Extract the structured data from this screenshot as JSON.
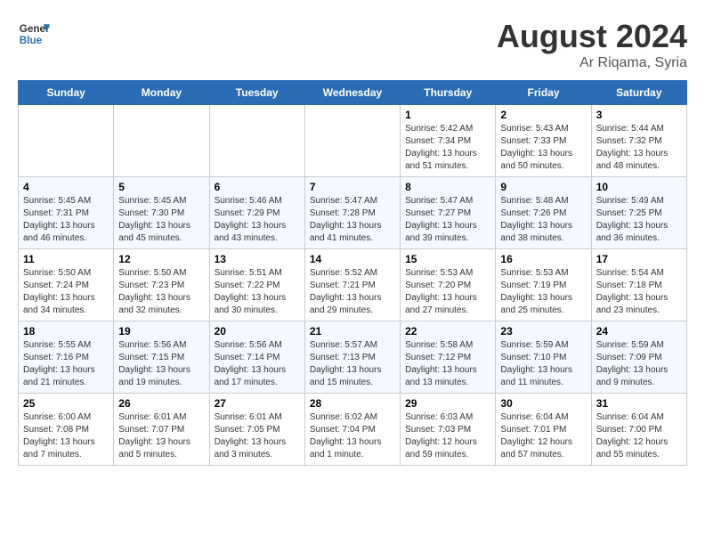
{
  "header": {
    "logo_general": "General",
    "logo_blue": "Blue",
    "month_year": "August 2024",
    "location": "Ar Riqama, Syria"
  },
  "weekdays": [
    "Sunday",
    "Monday",
    "Tuesday",
    "Wednesday",
    "Thursday",
    "Friday",
    "Saturday"
  ],
  "weeks": [
    [
      {
        "day": "",
        "info": ""
      },
      {
        "day": "",
        "info": ""
      },
      {
        "day": "",
        "info": ""
      },
      {
        "day": "",
        "info": ""
      },
      {
        "day": "1",
        "info": "Sunrise: 5:42 AM\nSunset: 7:34 PM\nDaylight: 13 hours and 51 minutes."
      },
      {
        "day": "2",
        "info": "Sunrise: 5:43 AM\nSunset: 7:33 PM\nDaylight: 13 hours and 50 minutes."
      },
      {
        "day": "3",
        "info": "Sunrise: 5:44 AM\nSunset: 7:32 PM\nDaylight: 13 hours and 48 minutes."
      }
    ],
    [
      {
        "day": "4",
        "info": "Sunrise: 5:45 AM\nSunset: 7:31 PM\nDaylight: 13 hours and 46 minutes."
      },
      {
        "day": "5",
        "info": "Sunrise: 5:45 AM\nSunset: 7:30 PM\nDaylight: 13 hours and 45 minutes."
      },
      {
        "day": "6",
        "info": "Sunrise: 5:46 AM\nSunset: 7:29 PM\nDaylight: 13 hours and 43 minutes."
      },
      {
        "day": "7",
        "info": "Sunrise: 5:47 AM\nSunset: 7:28 PM\nDaylight: 13 hours and 41 minutes."
      },
      {
        "day": "8",
        "info": "Sunrise: 5:47 AM\nSunset: 7:27 PM\nDaylight: 13 hours and 39 minutes."
      },
      {
        "day": "9",
        "info": "Sunrise: 5:48 AM\nSunset: 7:26 PM\nDaylight: 13 hours and 38 minutes."
      },
      {
        "day": "10",
        "info": "Sunrise: 5:49 AM\nSunset: 7:25 PM\nDaylight: 13 hours and 36 minutes."
      }
    ],
    [
      {
        "day": "11",
        "info": "Sunrise: 5:50 AM\nSunset: 7:24 PM\nDaylight: 13 hours and 34 minutes."
      },
      {
        "day": "12",
        "info": "Sunrise: 5:50 AM\nSunset: 7:23 PM\nDaylight: 13 hours and 32 minutes."
      },
      {
        "day": "13",
        "info": "Sunrise: 5:51 AM\nSunset: 7:22 PM\nDaylight: 13 hours and 30 minutes."
      },
      {
        "day": "14",
        "info": "Sunrise: 5:52 AM\nSunset: 7:21 PM\nDaylight: 13 hours and 29 minutes."
      },
      {
        "day": "15",
        "info": "Sunrise: 5:53 AM\nSunset: 7:20 PM\nDaylight: 13 hours and 27 minutes."
      },
      {
        "day": "16",
        "info": "Sunrise: 5:53 AM\nSunset: 7:19 PM\nDaylight: 13 hours and 25 minutes."
      },
      {
        "day": "17",
        "info": "Sunrise: 5:54 AM\nSunset: 7:18 PM\nDaylight: 13 hours and 23 minutes."
      }
    ],
    [
      {
        "day": "18",
        "info": "Sunrise: 5:55 AM\nSunset: 7:16 PM\nDaylight: 13 hours and 21 minutes."
      },
      {
        "day": "19",
        "info": "Sunrise: 5:56 AM\nSunset: 7:15 PM\nDaylight: 13 hours and 19 minutes."
      },
      {
        "day": "20",
        "info": "Sunrise: 5:56 AM\nSunset: 7:14 PM\nDaylight: 13 hours and 17 minutes."
      },
      {
        "day": "21",
        "info": "Sunrise: 5:57 AM\nSunset: 7:13 PM\nDaylight: 13 hours and 15 minutes."
      },
      {
        "day": "22",
        "info": "Sunrise: 5:58 AM\nSunset: 7:12 PM\nDaylight: 13 hours and 13 minutes."
      },
      {
        "day": "23",
        "info": "Sunrise: 5:59 AM\nSunset: 7:10 PM\nDaylight: 13 hours and 11 minutes."
      },
      {
        "day": "24",
        "info": "Sunrise: 5:59 AM\nSunset: 7:09 PM\nDaylight: 13 hours and 9 minutes."
      }
    ],
    [
      {
        "day": "25",
        "info": "Sunrise: 6:00 AM\nSunset: 7:08 PM\nDaylight: 13 hours and 7 minutes."
      },
      {
        "day": "26",
        "info": "Sunrise: 6:01 AM\nSunset: 7:07 PM\nDaylight: 13 hours and 5 minutes."
      },
      {
        "day": "27",
        "info": "Sunrise: 6:01 AM\nSunset: 7:05 PM\nDaylight: 13 hours and 3 minutes."
      },
      {
        "day": "28",
        "info": "Sunrise: 6:02 AM\nSunset: 7:04 PM\nDaylight: 13 hours and 1 minute."
      },
      {
        "day": "29",
        "info": "Sunrise: 6:03 AM\nSunset: 7:03 PM\nDaylight: 12 hours and 59 minutes."
      },
      {
        "day": "30",
        "info": "Sunrise: 6:04 AM\nSunset: 7:01 PM\nDaylight: 12 hours and 57 minutes."
      },
      {
        "day": "31",
        "info": "Sunrise: 6:04 AM\nSunset: 7:00 PM\nDaylight: 12 hours and 55 minutes."
      }
    ]
  ]
}
